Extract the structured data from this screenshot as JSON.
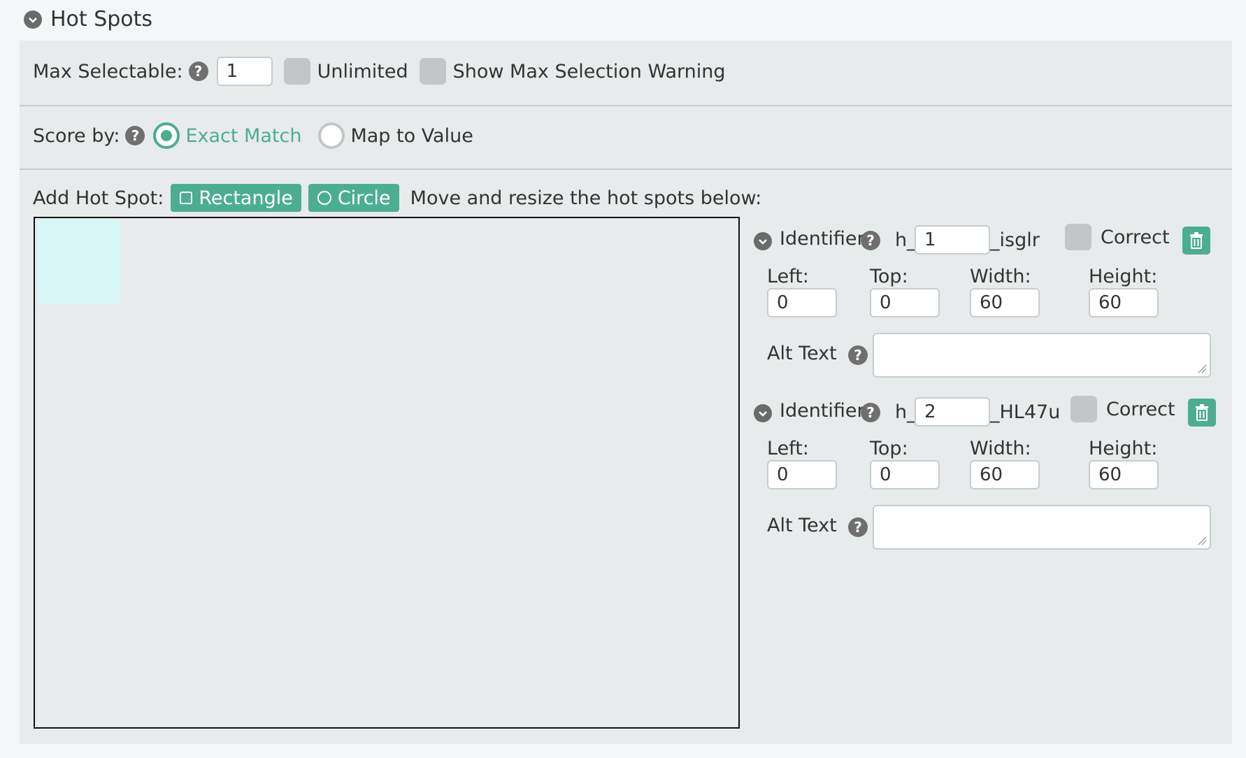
{
  "section": {
    "title": "Hot Spots"
  },
  "max_selectable": {
    "label": "Max Selectable:",
    "value": "1",
    "unlimited_label": "Unlimited",
    "warning_label": "Show Max Selection Warning"
  },
  "score_by": {
    "label": "Score by:",
    "options": [
      {
        "label": "Exact Match",
        "selected": true
      },
      {
        "label": "Map to Value",
        "selected": false
      }
    ]
  },
  "add_hotspot": {
    "label": "Add Hot Spot:",
    "rectangle_label": "Rectangle",
    "circle_label": "Circle",
    "instructions": "Move and resize the hot spots below:"
  },
  "hotspots": [
    {
      "identifier_label": "Identifier",
      "prefix": "h_",
      "id_value": "1",
      "suffix": "_isglr",
      "correct_label": "Correct",
      "left_label": "Left:",
      "left": "0",
      "top_label": "Top:",
      "top": "0",
      "width_label": "Width:",
      "width": "60",
      "height_label": "Height:",
      "height": "60",
      "alt_label": "Alt Text",
      "alt_value": ""
    },
    {
      "identifier_label": "Identifier",
      "prefix": "h_",
      "id_value": "2",
      "suffix": "_HL47u",
      "correct_label": "Correct",
      "left_label": "Left:",
      "left": "0",
      "top_label": "Top:",
      "top": "0",
      "width_label": "Width:",
      "width": "60",
      "height_label": "Height:",
      "height": "60",
      "alt_label": "Alt Text",
      "alt_value": ""
    }
  ],
  "colors": {
    "accent": "#4cae90",
    "panel": "#e8ebeb",
    "checkbox": "#c2c6c6"
  },
  "icons": [
    "chevron-down-icon",
    "help-icon",
    "square-icon",
    "circle-icon",
    "trash-icon",
    "resize-handle-icon"
  ]
}
